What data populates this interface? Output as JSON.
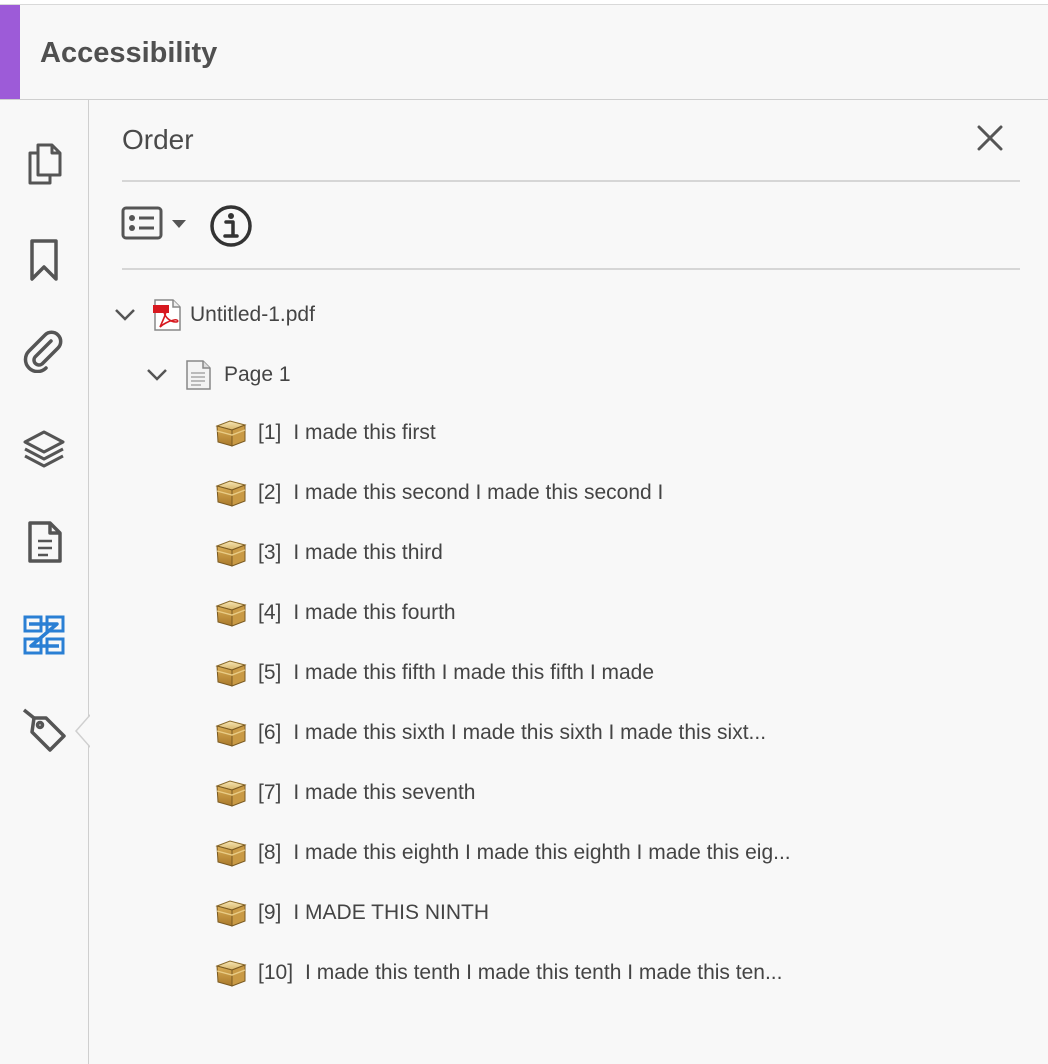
{
  "app": {
    "title": "Accessibility",
    "accent_color": "#9d5bd8"
  },
  "rail": {
    "icons": [
      {
        "name": "page-thumbnails-icon"
      },
      {
        "name": "bookmarks-icon"
      },
      {
        "name": "attachments-icon"
      },
      {
        "name": "layers-icon"
      },
      {
        "name": "content-icon"
      },
      {
        "name": "order-icon",
        "active": true,
        "color": "#2a7fd4"
      },
      {
        "name": "tags-icon"
      }
    ]
  },
  "panel": {
    "title": "Order",
    "close_icon": "close-icon",
    "options_icon": "options-list-icon",
    "info_icon": "info-icon"
  },
  "tree": {
    "document": {
      "label": "Untitled-1.pdf",
      "icon": "pdf-file-icon"
    },
    "page": {
      "label": "Page 1",
      "icon": "page-icon"
    },
    "items": [
      {
        "num": "[1]",
        "text": "I made this first"
      },
      {
        "num": "[2]",
        "text": "I made this second I made this second I"
      },
      {
        "num": "[3]",
        "text": "I made this third"
      },
      {
        "num": "[4]",
        "text": "I made this fourth"
      },
      {
        "num": "[5]",
        "text": "I made this fifth I made this fifth I made"
      },
      {
        "num": "[6]",
        "text": "I made this sixth I made this sixth I made this sixt..."
      },
      {
        "num": "[7]",
        "text": "I made this seventh"
      },
      {
        "num": "[8]",
        "text": "I made this eighth I made this eighth I made this eig..."
      },
      {
        "num": "[9]",
        "text": "I MADE THIS NINTH"
      },
      {
        "num": "[10]",
        "text": "I made this tenth I made this tenth I made this ten..."
      }
    ]
  }
}
